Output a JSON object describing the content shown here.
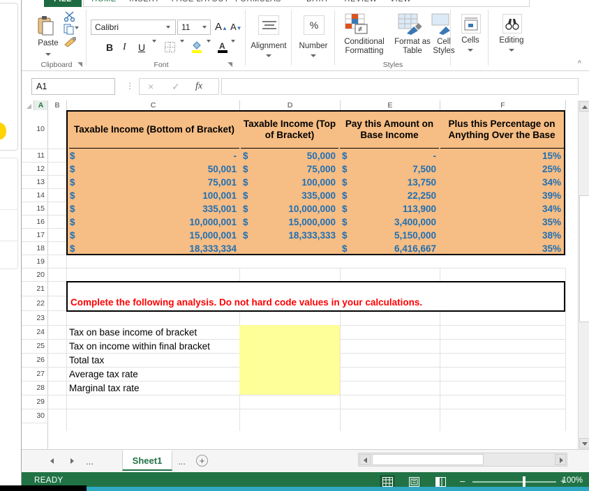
{
  "ribbon": {
    "tabs": [
      {
        "label": "FILE",
        "active": false
      },
      {
        "label": "HOME",
        "active": true
      },
      {
        "label": "INSERT",
        "active": false
      },
      {
        "label": "PAGE LAYOUT",
        "active": false
      },
      {
        "label": "FORMULAS",
        "active": false
      },
      {
        "label": "DATA",
        "active": false
      },
      {
        "label": "REVIEW",
        "active": false
      },
      {
        "label": "VIEW",
        "active": false
      }
    ],
    "groups": {
      "clipboard": {
        "label": "Clipboard",
        "paste": "Paste"
      },
      "font": {
        "label": "Font",
        "font_name": "Calibri",
        "font_size": "11",
        "bold": "B",
        "italic": "I",
        "underline": "U"
      },
      "alignment": {
        "label": "Alignment"
      },
      "number": {
        "label": "Number",
        "symbol": "%"
      },
      "styles": {
        "label": "Styles",
        "conditional_formatting": "Conditional Formatting",
        "format_as_table": "Format as Table",
        "cell_styles": "Cell Styles"
      },
      "cells": {
        "label": "Cells"
      },
      "editing": {
        "label": "Editing"
      }
    }
  },
  "formula_bar": {
    "name_box": "A1",
    "formula": "",
    "cancel_icon": "×",
    "enter_icon": "✓",
    "function_icon": "fx"
  },
  "grid": {
    "columns": [
      "A",
      "B",
      "C",
      "D",
      "E",
      "F"
    ],
    "selected_column": "A",
    "rows": [
      10,
      11,
      12,
      13,
      14,
      15,
      16,
      17,
      18,
      19,
      20,
      21,
      22,
      23,
      24,
      25,
      26,
      27,
      28,
      29,
      30
    ],
    "colors": {
      "table_fill": "#f6bd84",
      "value_text": "#1f6fb4",
      "note_text": "#ff0000",
      "input_fill": "#ffff99",
      "accent": "#217346"
    }
  },
  "tax_table": {
    "headers": [
      "Taxable Income (Bottom of Bracket)",
      "Taxable Income (Top of Bracket)",
      "Pay this Amount on Base Income",
      "Plus this Percentage on Anything Over the Base"
    ],
    "currency_symbol": "$",
    "rows": [
      {
        "row": "11",
        "bottom": "-",
        "top": "50,000",
        "base_tax": "-",
        "rate": "15%"
      },
      {
        "row": "12",
        "bottom": "50,001",
        "top": "75,000",
        "base_tax": "7,500",
        "rate": "25%"
      },
      {
        "row": "13",
        "bottom": "75,001",
        "top": "100,000",
        "base_tax": "13,750",
        "rate": "34%"
      },
      {
        "row": "14",
        "bottom": "100,001",
        "top": "335,000",
        "base_tax": "22,250",
        "rate": "39%"
      },
      {
        "row": "15",
        "bottom": "335,001",
        "top": "10,000,000",
        "base_tax": "113,900",
        "rate": "34%"
      },
      {
        "row": "16",
        "bottom": "10,000,001",
        "top": "15,000,000",
        "base_tax": "3,400,000",
        "rate": "35%"
      },
      {
        "row": "17",
        "bottom": "15,000,001",
        "top": "18,333,333",
        "base_tax": "5,150,000",
        "rate": "38%"
      },
      {
        "row": "18",
        "bottom": "18,333,334",
        "top": "",
        "base_tax": "6,416,667",
        "rate": "35%"
      }
    ]
  },
  "instruction": {
    "text": "Complete the following analysis. Do not hard code values in your calculations."
  },
  "analysis": {
    "items": [
      {
        "row": "24",
        "label": "Tax on base income of bracket",
        "value": ""
      },
      {
        "row": "25",
        "label": "Tax on income within final bracket",
        "value": ""
      },
      {
        "row": "26",
        "label": "Total tax",
        "value": ""
      },
      {
        "row": "27",
        "label": "Average tax rate",
        "value": ""
      },
      {
        "row": "28",
        "label": "Marginal tax rate",
        "value": ""
      }
    ]
  },
  "sheet_tabs": {
    "tabs": [
      "Sheet1"
    ],
    "active": "Sheet1",
    "prev_icon": "◄",
    "next_icon": "►",
    "overflow_left": "...",
    "overflow_right": "...",
    "add_icon": "+"
  },
  "status_bar": {
    "status": "READY",
    "zoom": "100%",
    "zoom_out": "–",
    "zoom_in": "+",
    "views": [
      "normal-view",
      "page-layout-view",
      "page-break-view"
    ]
  }
}
